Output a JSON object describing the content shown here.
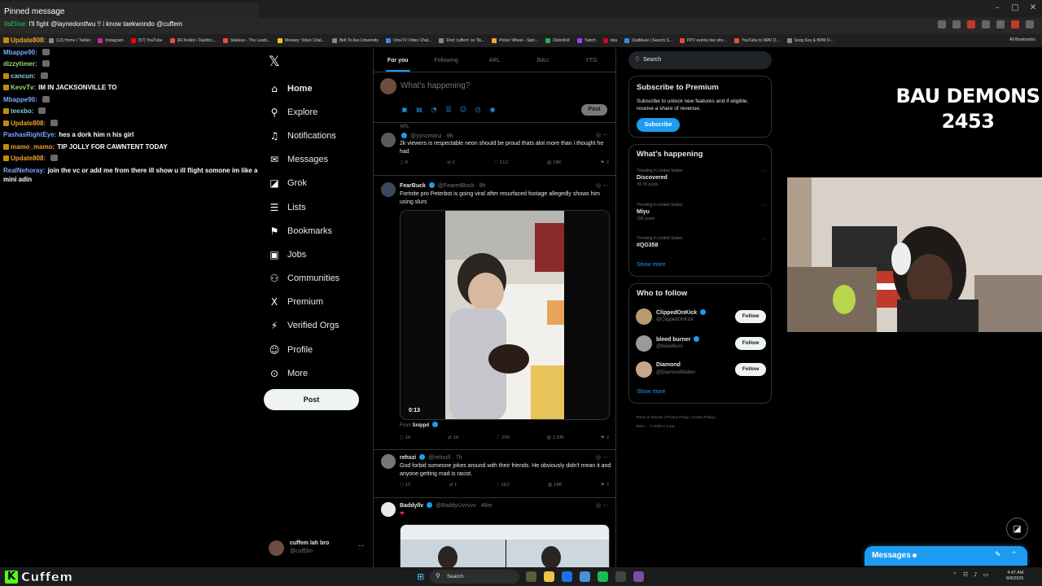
{
  "chat_overlay": {
    "pinned_title": "Pinned message",
    "pinned_user": "ItsElise:",
    "pinned_text": "I'll fight @laynedontfwu !! i know taekwondo @cuffem",
    "messages": [
      {
        "user": "Update808:",
        "text": "",
        "color": "#e9a629",
        "badge": true,
        "emote": false
      },
      {
        "user": "Mbappe90:",
        "text": "",
        "color": "#7aa7ff",
        "badge": false,
        "emote": true
      },
      {
        "user": "dizzytimer:",
        "text": "",
        "color": "#9ad86a",
        "badge": false,
        "emote": true
      },
      {
        "user": "cancun:",
        "text": "",
        "color": "#7fd4d4",
        "badge": true,
        "emote": true
      },
      {
        "user": "KevvTv:",
        "text": "IM IN JACKSONVILLE TO",
        "color": "#9ad86a",
        "badge": true,
        "emote": false
      },
      {
        "user": "Mbappe90:",
        "text": "",
        "color": "#7aa7ff",
        "badge": false,
        "emote": true
      },
      {
        "user": "teexbo:",
        "text": "",
        "color": "#7fd4d4",
        "badge": true,
        "emote": true
      },
      {
        "user": "Update808:",
        "text": "",
        "color": "#e9a629",
        "badge": true,
        "emote": true
      },
      {
        "user": "PashasRightEye:",
        "text": "hes a dork him n his girl",
        "color": "#7aa7ff",
        "badge": false,
        "emote": false
      },
      {
        "user": "mamo_mamo:",
        "text": "TIP JOLLY FOR CAWNTENT TODAY",
        "color": "#e9a629",
        "badge": true,
        "emote": false
      },
      {
        "user": "Update808:",
        "text": "",
        "color": "#e9a629",
        "badge": true,
        "emote": true
      },
      {
        "user": "RealNehoray:",
        "text": "join the vc or add me from there ill show u ill flight somone im like a mini adin",
        "color": "#7aa7ff",
        "badge": false,
        "emote": false
      }
    ]
  },
  "browser": {
    "bookmarks": [
      {
        "label": "(12) Home / Twitter",
        "color": "#888"
      },
      {
        "label": "Instagram",
        "color": "#d6249f"
      },
      {
        "label": "(57) YouTube",
        "color": "#ff0000"
      },
      {
        "label": "IRLToolkit • Dashbo...",
        "color": "#e84d3d"
      },
      {
        "label": "Stakeus - The Leadi...",
        "color": "#e84d3d"
      },
      {
        "label": "Monkey: Video Chat...",
        "color": "#f5c518"
      },
      {
        "label": "Belt To Ass University",
        "color": "#888"
      },
      {
        "label": "OmeTV Video Chat...",
        "color": "#3a8dde"
      },
      {
        "label": "Find 'cuffem' on Tik...",
        "color": "#888"
      },
      {
        "label": "Picker Wheel - Spin...",
        "color": "#f5a623"
      },
      {
        "label": "DistroKid",
        "color": "#27ae60"
      },
      {
        "label": "Twitch",
        "color": "#9146ff"
      },
      {
        "label": "nba",
        "color": "#c9082a"
      },
      {
        "label": "StatMuse | Search S...",
        "color": "#3a8dde"
      },
      {
        "label": "PPV events live stre...",
        "color": "#e84d3d"
      },
      {
        "label": "YouTube to WAV D...",
        "color": "#e84d3d"
      },
      {
        "label": "Song Key & BPM Fi...",
        "color": "#888"
      }
    ],
    "all_bookmarks": "All Bookmarks"
  },
  "nav": {
    "items": [
      {
        "label": "Home",
        "icon": "⌂",
        "icon_name": "home-icon",
        "active": true
      },
      {
        "label": "Explore",
        "icon": "⚲",
        "icon_name": "explore-icon",
        "active": false
      },
      {
        "label": "Notifications",
        "icon": "♫",
        "icon_name": "bell-icon",
        "active": false
      },
      {
        "label": "Messages",
        "icon": "✉",
        "icon_name": "messages-icon",
        "active": false
      },
      {
        "label": "Grok",
        "icon": "◪",
        "icon_name": "grok-icon",
        "active": false
      },
      {
        "label": "Lists",
        "icon": "☰",
        "icon_name": "lists-icon",
        "active": false
      },
      {
        "label": "Bookmarks",
        "icon": "⚑",
        "icon_name": "bookmark-icon",
        "active": false
      },
      {
        "label": "Jobs",
        "icon": "▣",
        "icon_name": "jobs-icon",
        "active": false
      },
      {
        "label": "Communities",
        "icon": "⚇",
        "icon_name": "communities-icon",
        "active": false
      },
      {
        "label": "Premium",
        "icon": "X",
        "icon_name": "premium-icon",
        "active": false
      },
      {
        "label": "Verified Orgs",
        "icon": "⚡",
        "icon_name": "verified-orgs-icon",
        "active": false
      },
      {
        "label": "Profile",
        "icon": "☺",
        "icon_name": "profile-icon",
        "active": false
      },
      {
        "label": "More",
        "icon": "⊙",
        "icon_name": "more-icon",
        "active": false
      }
    ],
    "post_label": "Post",
    "account_name": "cuffem lah bro",
    "account_handle": "@cuff3m"
  },
  "timeline": {
    "tabs": [
      "For you",
      "Following",
      "ARL",
      "BAU",
      "YTG"
    ],
    "compose_placeholder": "What's happening?",
    "compose_post": "Post",
    "tweets": [
      {
        "context": "ARL",
        "handle": "@yynzmanz · 9h",
        "text": "2k viewers is respectable neon should be proud thats alot more than i thought he had",
        "replies": "6",
        "reposts": "2",
        "likes": "112",
        "views": "18K"
      },
      {
        "name": "FearBuck",
        "handle": "@FearedBuck · 8h",
        "text": "Fortnite pro Peterbot is going viral after resurfaced footage allegedly shows him using slurs",
        "duration": "0:13",
        "from_label": "From",
        "from_name": "Snippd",
        "replies": "1K",
        "reposts": "1K",
        "likes": "25K",
        "views": "2.8M"
      },
      {
        "name": "rehxzi",
        "handle": "@rehxzll · 7h",
        "text": "God forbid someone jokes around with their friends. He obviously didn't mean it and anyone getting mad is racist.",
        "replies": "15",
        "reposts": "1",
        "likes": "262",
        "views": "18K"
      },
      {
        "name": "Baddyllv",
        "handle": "@BaddyUvvvvv · 46m"
      }
    ]
  },
  "right": {
    "search_placeholder": "Search",
    "premium_title": "Subscribe to Premium",
    "premium_text": "Subscribe to unlock new features and if eligible, receive a share of revenue.",
    "subscribe_label": "Subscribe",
    "happening_title": "What's happening",
    "trends": [
      {
        "context": "Trending in United States",
        "name": "Discovered",
        "count": "33.7K posts"
      },
      {
        "context": "Trending in United States",
        "name": "Miyu",
        "count": "16K posts"
      },
      {
        "context": "Trending in United States",
        "name": "#QG358",
        "count": ""
      }
    ],
    "show_more": "Show more",
    "follow_title": "Who to follow",
    "who_to_follow": [
      {
        "name": "ClippedOnKick",
        "handle": "@ClippedOnKick",
        "color": "#b89a6e"
      },
      {
        "name": "bleed burner",
        "handle": "@bleedburn",
        "color": "#9a9a9a"
      },
      {
        "name": "Diamond",
        "handle": "@DiamondWallen",
        "color": "#c7a58a"
      }
    ],
    "follow_label": "Follow",
    "footer_line1": "Terms of Service  |  Privacy Policy  |  Cookie Policy  |",
    "footer_line2": "More ···  © 2025 X Corp."
  },
  "overlay": {
    "title_line1": "BAU DEMONS",
    "title_line2": "2453"
  },
  "messages_drawer": {
    "label": "Messages"
  },
  "taskbar": {
    "kick_name": "Cuffem",
    "search_label": "Search",
    "time": "4:47 AM",
    "date": "8/8/2025",
    "app_colors": [
      "#5a5a3c",
      "#f0c14b",
      "#1a73e8",
      "#4a90d9",
      "#1db954",
      "#444",
      "#7b4ea3"
    ]
  }
}
